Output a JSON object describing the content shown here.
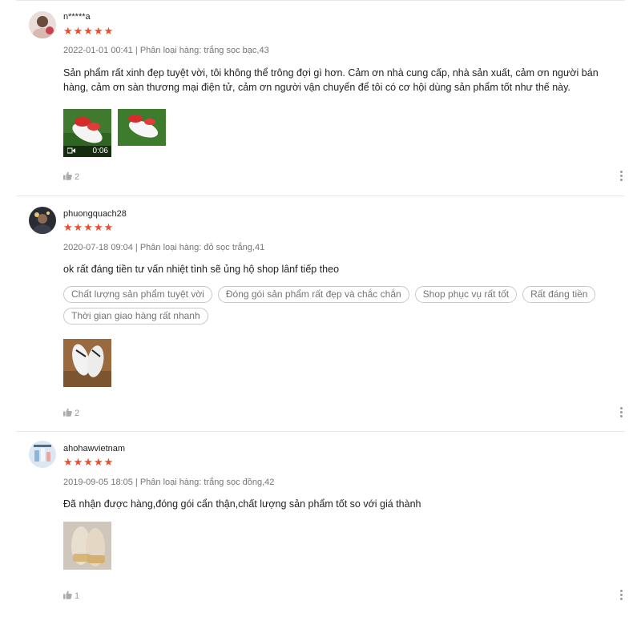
{
  "reviews": [
    {
      "username": "n*****a",
      "stars": "★★★★★",
      "date": "2022-01-01 00:41",
      "variation": "Phân loại hàng: trắng sọc bạc,43",
      "content": "Sản phẩm rất xinh đẹp tuyệt vời, tôi không thể trông đợi gì hơn. Cảm ơn nhà cung cấp, nhà sản xuất, cảm ơn người bán hàng, cảm ơn sàn thương mại điện tử, cảm ơn người vận chuyển để tôi có cơ hội dùng sản phẩm tốt như thế này.",
      "video_duration": "0:06",
      "likes": "2"
    },
    {
      "username": "phuongquach28",
      "stars": "★★★★★",
      "date": "2020-07-18 09:04",
      "variation": "Phân loại hàng: đỏ sọc trắng,41",
      "content": "ok rất đáng tiền tư vấn nhiệt tình sẽ ủng hộ shop lânf tiếp theo",
      "tags": [
        "Chất lượng sản phẩm tuyệt vời",
        "Đóng gói sản phẩm rất đẹp và chắc chắn",
        "Shop phục vụ rất tốt",
        "Rất đáng tiền",
        "Thời gian giao hàng rất nhanh"
      ],
      "likes": "2"
    },
    {
      "username": "ahohawvietnam",
      "stars": "★★★★★",
      "date": "2019-09-05 18:05",
      "variation": "Phân loại hàng: trắng sọc đồng,42",
      "content": "Đã nhận được hàng,đóng gói cẩn thận,chất lượng sản phẩm tốt so với giá thành",
      "likes": "1"
    }
  ],
  "separator": " | ",
  "colors": {
    "star": "#ee4d2d",
    "muted": "#757575"
  },
  "icons": {
    "like": "thumbs-up-icon",
    "more": "more-vertical-icon",
    "video": "video-camera-icon"
  }
}
